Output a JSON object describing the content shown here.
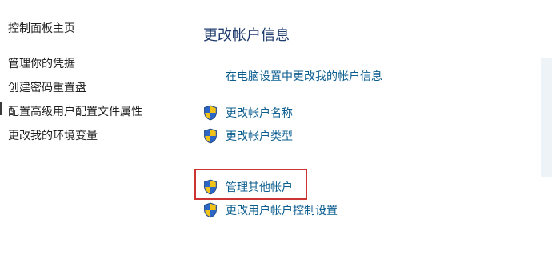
{
  "sidebar": {
    "items": [
      {
        "label": "控制面板主页"
      },
      {
        "label": "管理你的凭据"
      },
      {
        "label": "创建密码重置盘"
      },
      {
        "label": "配置高级用户配置文件属性"
      },
      {
        "label": "更改我的环境变量"
      }
    ]
  },
  "main": {
    "title": "更改帐户信息",
    "pc_settings_link": "在电脑设置中更改我的帐户信息",
    "tasks": [
      {
        "label": "更改帐户名称",
        "icon": "uac-shield-icon"
      },
      {
        "label": "更改帐户类型",
        "icon": "uac-shield-icon"
      },
      {
        "label": "管理其他帐户",
        "icon": "uac-shield-icon"
      },
      {
        "label": "更改用户帐户控制设置",
        "icon": "uac-shield-icon"
      }
    ]
  },
  "colors": {
    "title": "#1e3b6e",
    "link": "#0b5d8f",
    "highlight_border": "#cc3333",
    "shield_blue": "#2b66c7",
    "shield_yellow": "#f2c316"
  }
}
